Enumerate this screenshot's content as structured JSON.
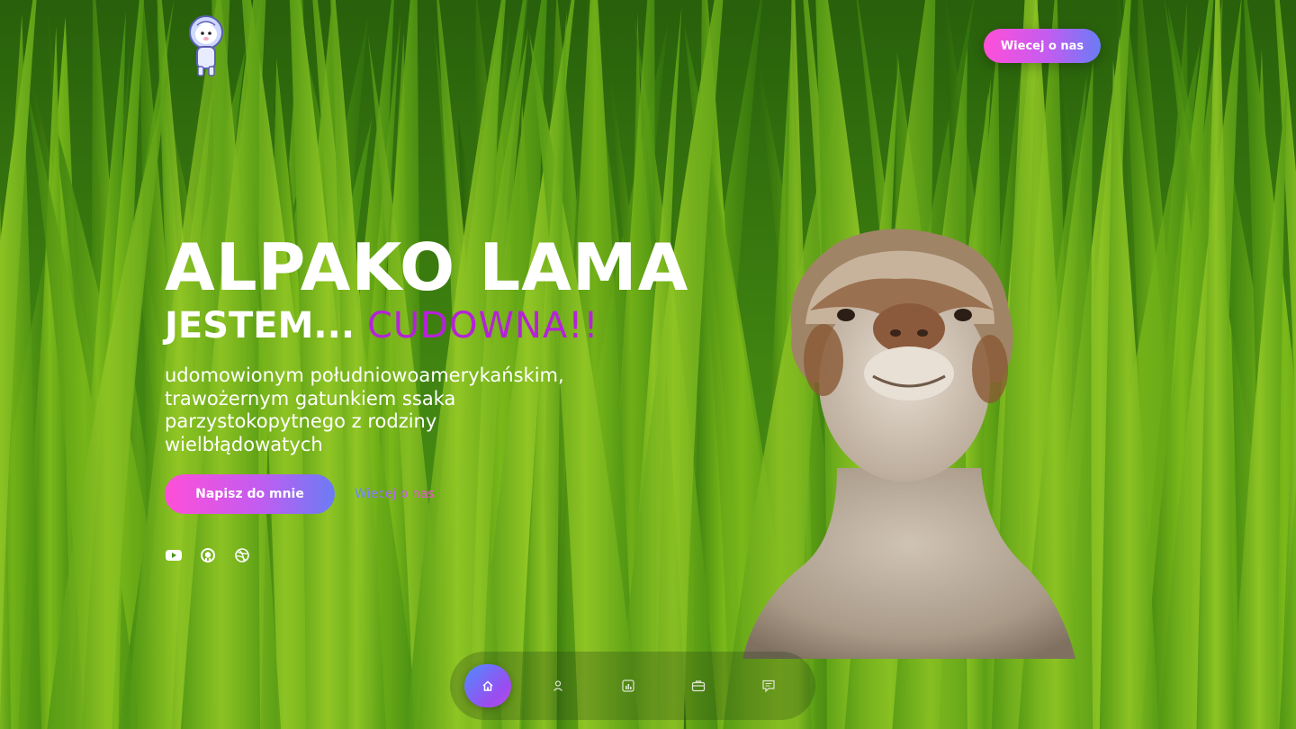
{
  "header": {
    "cta_label": "Wiecej o nas",
    "logo_icon": "alpaca-astronaut-logo"
  },
  "hero": {
    "title": "ALPAKO LAMA",
    "subtitle_prefix": "JESTEM...",
    "subtitle_accent": "CUDOWNA!!",
    "description": "udomowionym południowoamerykańskim, trawożernym gatunkiem ssaka parzystokopytnego z rodziny wielbłądowatych",
    "primary_button": "Napisz do mnie",
    "secondary_link": "Wiecej o nas"
  },
  "socials": [
    "youtube-icon",
    "github-icon",
    "dribbble-icon"
  ],
  "bottom_nav": {
    "items": [
      "home-icon",
      "user-icon",
      "stats-icon",
      "briefcase-icon",
      "message-icon"
    ],
    "active": "home-icon"
  },
  "colors": {
    "accent_pink": "#ff4fd8",
    "accent_purple": "#b522d8",
    "accent_blue": "#5f8cff",
    "text": "#ffffff",
    "grass_dark": "#2f6a0c",
    "grass_light": "#8fd21f"
  }
}
